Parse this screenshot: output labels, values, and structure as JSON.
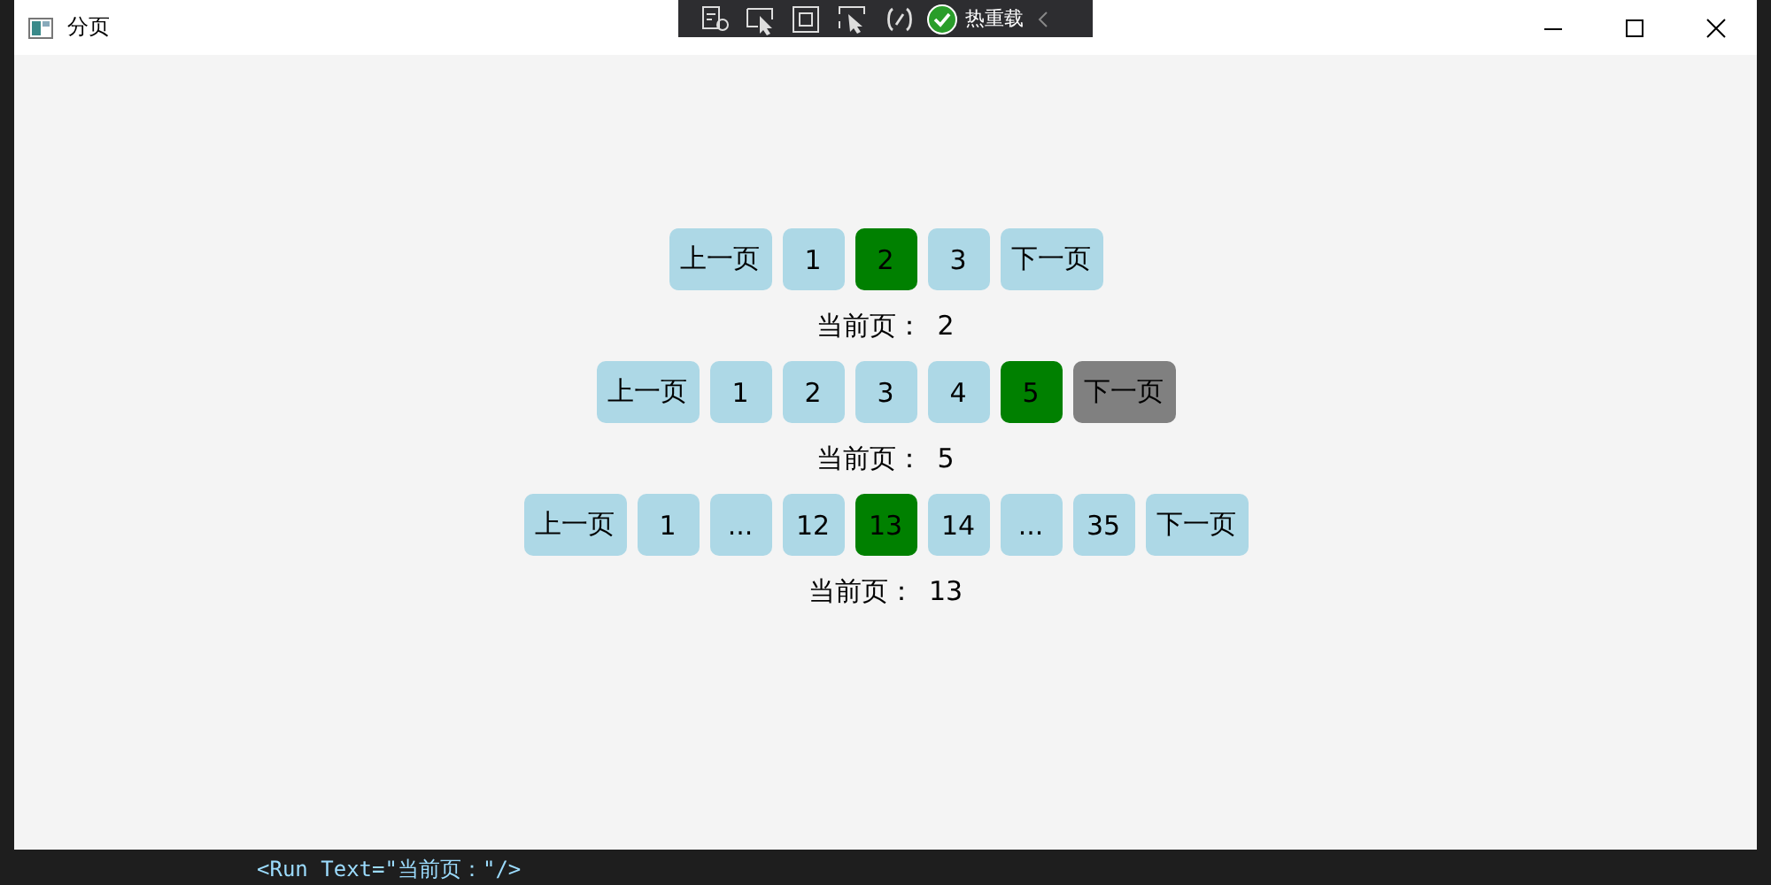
{
  "window": {
    "title": "分页"
  },
  "debug_toolbar": {
    "hot_reload": "热重载"
  },
  "pagers": [
    {
      "buttons": [
        {
          "kind": "prev",
          "label": "上一页",
          "selected": false,
          "disabled": false
        },
        {
          "kind": "page",
          "label": "1",
          "selected": false,
          "disabled": false
        },
        {
          "kind": "page",
          "label": "2",
          "selected": true,
          "disabled": false
        },
        {
          "kind": "page",
          "label": "3",
          "selected": false,
          "disabled": false
        },
        {
          "kind": "next",
          "label": "下一页",
          "selected": false,
          "disabled": false
        }
      ],
      "caption": "当前页：",
      "current": "2"
    },
    {
      "buttons": [
        {
          "kind": "prev",
          "label": "上一页",
          "selected": false,
          "disabled": false
        },
        {
          "kind": "page",
          "label": "1",
          "selected": false,
          "disabled": false
        },
        {
          "kind": "page",
          "label": "2",
          "selected": false,
          "disabled": false
        },
        {
          "kind": "page",
          "label": "3",
          "selected": false,
          "disabled": false
        },
        {
          "kind": "page",
          "label": "4",
          "selected": false,
          "disabled": false
        },
        {
          "kind": "page",
          "label": "5",
          "selected": true,
          "disabled": false
        },
        {
          "kind": "next",
          "label": "下一页",
          "selected": false,
          "disabled": true
        }
      ],
      "caption": "当前页：",
      "current": "5"
    },
    {
      "buttons": [
        {
          "kind": "prev",
          "label": "上一页",
          "selected": false,
          "disabled": false
        },
        {
          "kind": "page",
          "label": "1",
          "selected": false,
          "disabled": false
        },
        {
          "kind": "ellipsis",
          "label": "...",
          "selected": false,
          "disabled": false
        },
        {
          "kind": "page",
          "label": "12",
          "selected": false,
          "disabled": false
        },
        {
          "kind": "page",
          "label": "13",
          "selected": true,
          "disabled": false
        },
        {
          "kind": "page",
          "label": "14",
          "selected": false,
          "disabled": false
        },
        {
          "kind": "ellipsis",
          "label": "...",
          "selected": false,
          "disabled": false
        },
        {
          "kind": "page",
          "label": "35",
          "selected": false,
          "disabled": false
        },
        {
          "kind": "next",
          "label": "下一页",
          "selected": false,
          "disabled": false
        }
      ],
      "caption": "当前页：",
      "current": "13"
    }
  ],
  "editor_behind": {
    "code_line": "<Run Text=\"当前页：\"/>"
  }
}
